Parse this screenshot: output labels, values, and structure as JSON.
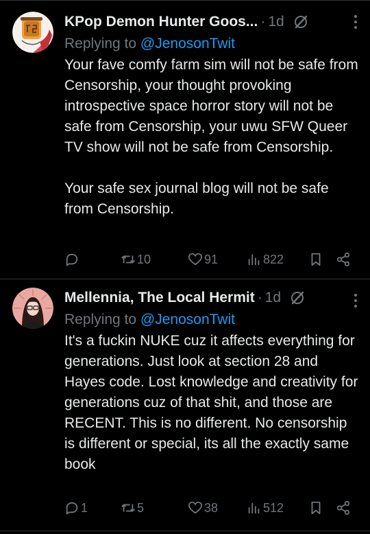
{
  "tweets": [
    {
      "name": "KPop Demon Hunter Goos...",
      "time": "1d",
      "replying_prefix": "Replying to ",
      "replying_handle": "@JenosonTwit",
      "text_p1": "Your fave comfy farm sim will not be safe from Censorship, your thought provoking introspective space horror story will not be safe from Censorship, your uwu SFW Queer TV show will not be safe from Censorship.",
      "text_p2": "Your safe sex journal blog will not be safe from Censorship.",
      "reply_count": "",
      "retweet_count": "10",
      "like_count": "91",
      "view_count": "822"
    },
    {
      "name": "Mellennia, The Local Hermit",
      "time": "1d",
      "replying_prefix": "Replying to ",
      "replying_handle": "@JenosonTwit",
      "text_p1": "It's a fuckin NUKE cuz it affects everything for generations. Just look at section 28 and Hayes code. Lost knowledge and creativity for generations cuz of that shit, and those are RECENT. This is no different. No censorship is different or special, its all the exactly same book",
      "reply_count": "1",
      "retweet_count": "5",
      "like_count": "38",
      "view_count": "512"
    }
  ],
  "colors": {
    "background": "#000000",
    "text": "#e7e9ea",
    "muted": "#71767b",
    "link": "#1d9bf0",
    "divider": "#2f3336"
  }
}
